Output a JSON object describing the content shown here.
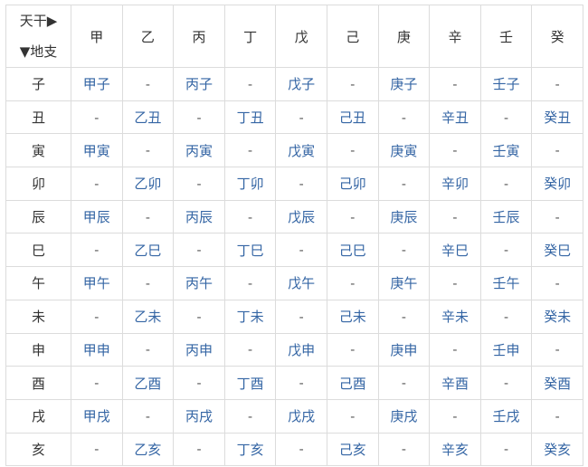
{
  "corner": {
    "stems_label": "天干▶",
    "branches_label": "▼地支"
  },
  "colors": {
    "text": "#333333",
    "link": "#3465a4",
    "border": "#dcdcdc"
  },
  "stems": [
    "甲",
    "乙",
    "丙",
    "丁",
    "戊",
    "己",
    "庚",
    "辛",
    "壬",
    "癸"
  ],
  "rows": [
    {
      "branch": "子",
      "cells": [
        "甲子",
        "-",
        "丙子",
        "-",
        "戊子",
        "-",
        "庚子",
        "-",
        "壬子",
        "-"
      ]
    },
    {
      "branch": "丑",
      "cells": [
        "-",
        "乙丑",
        "-",
        "丁丑",
        "-",
        "己丑",
        "-",
        "辛丑",
        "-",
        "癸丑"
      ]
    },
    {
      "branch": "寅",
      "cells": [
        "甲寅",
        "-",
        "丙寅",
        "-",
        "戊寅",
        "-",
        "庚寅",
        "-",
        "壬寅",
        "-"
      ]
    },
    {
      "branch": "卯",
      "cells": [
        "-",
        "乙卯",
        "-",
        "丁卯",
        "-",
        "己卯",
        "-",
        "辛卯",
        "-",
        "癸卯"
      ]
    },
    {
      "branch": "辰",
      "cells": [
        "甲辰",
        "-",
        "丙辰",
        "-",
        "戊辰",
        "-",
        "庚辰",
        "-",
        "壬辰",
        "-"
      ]
    },
    {
      "branch": "巳",
      "cells": [
        "-",
        "乙巳",
        "-",
        "丁巳",
        "-",
        "己巳",
        "-",
        "辛巳",
        "-",
        "癸巳"
      ]
    },
    {
      "branch": "午",
      "cells": [
        "甲午",
        "-",
        "丙午",
        "-",
        "戊午",
        "-",
        "庚午",
        "-",
        "壬午",
        "-"
      ]
    },
    {
      "branch": "未",
      "cells": [
        "-",
        "乙未",
        "-",
        "丁未",
        "-",
        "己未",
        "-",
        "辛未",
        "-",
        "癸未"
      ]
    },
    {
      "branch": "申",
      "cells": [
        "甲申",
        "-",
        "丙申",
        "-",
        "戊申",
        "-",
        "庚申",
        "-",
        "壬申",
        "-"
      ]
    },
    {
      "branch": "酉",
      "cells": [
        "-",
        "乙酉",
        "-",
        "丁酉",
        "-",
        "己酉",
        "-",
        "辛酉",
        "-",
        "癸酉"
      ]
    },
    {
      "branch": "戌",
      "cells": [
        "甲戌",
        "-",
        "丙戌",
        "-",
        "戊戌",
        "-",
        "庚戌",
        "-",
        "壬戌",
        "-"
      ]
    },
    {
      "branch": "亥",
      "cells": [
        "-",
        "乙亥",
        "-",
        "丁亥",
        "-",
        "己亥",
        "-",
        "辛亥",
        "-",
        "癸亥"
      ]
    }
  ]
}
